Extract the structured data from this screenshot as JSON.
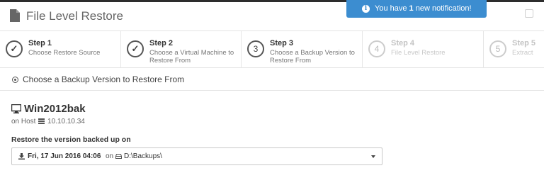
{
  "header": {
    "title": "File Level Restore",
    "icon": "document-icon"
  },
  "notification": {
    "prefix": "You have ",
    "count": "1",
    "suffix": " new notification!",
    "icon": "info-icon",
    "color": "#3c8dd0"
  },
  "steps": [
    {
      "title": "Step 1",
      "desc": "Choose Restore Source",
      "marker": "✓",
      "state": "done"
    },
    {
      "title": "Step 2",
      "desc": "Choose a Virtual Machine to Restore From",
      "marker": "✓",
      "state": "done"
    },
    {
      "title": "Step 3",
      "desc": "Choose a Backup Version to Restore From",
      "marker": "3",
      "state": "current"
    },
    {
      "title": "Step 4",
      "desc": "File Level Restore",
      "marker": "4",
      "state": "inactive"
    },
    {
      "title": "Step 5",
      "desc": "Extract",
      "marker": "5",
      "state": "inactive"
    }
  ],
  "section": {
    "heading": "Choose a Backup Version to Restore From"
  },
  "vm": {
    "name": "Win2012bak",
    "host_prefix": "on Host",
    "host_ip": "10.10.10.34"
  },
  "restore": {
    "label": "Restore the version backed up on",
    "selected_date": "Fri, 17 Jun 2016 04:06",
    "on_text": "on",
    "path": "D:\\Backups\\"
  }
}
